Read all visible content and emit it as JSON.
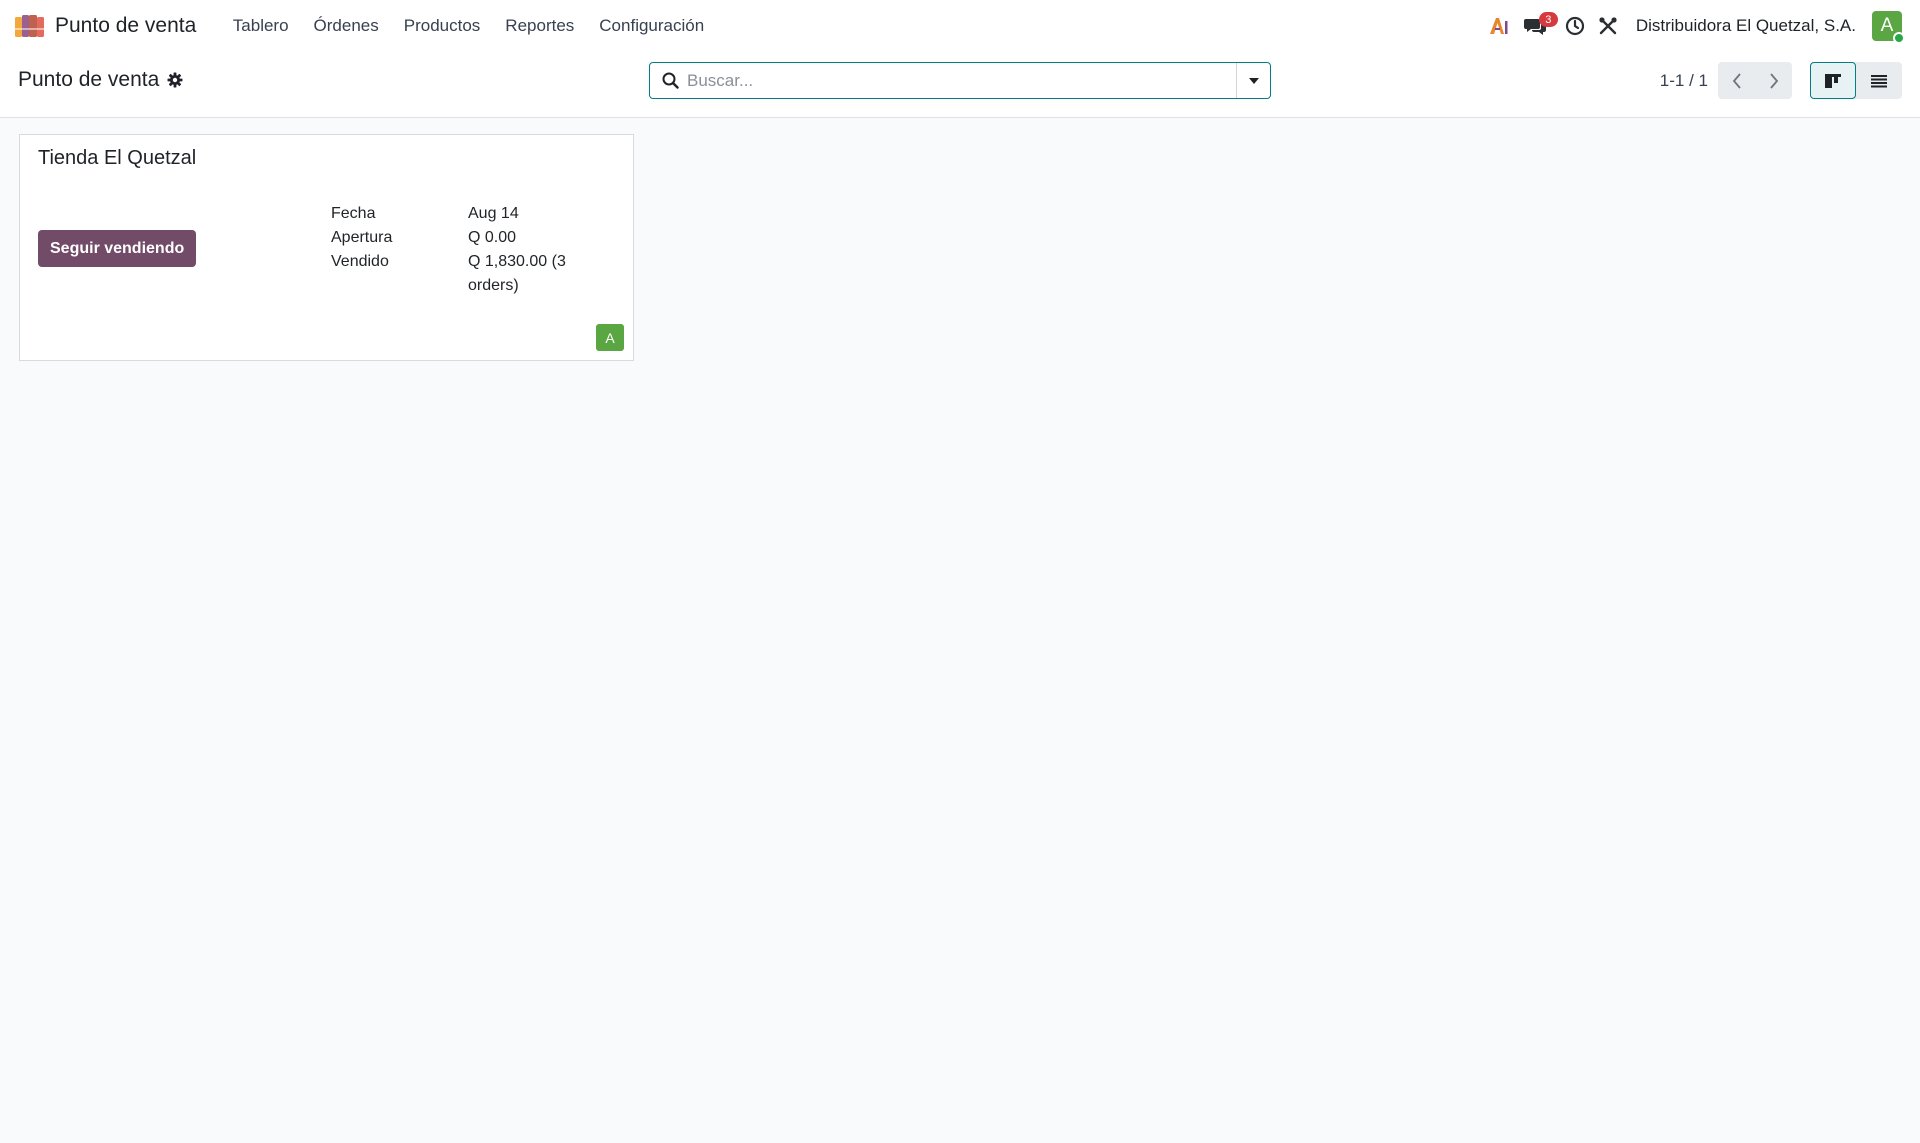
{
  "navbar": {
    "app_name": "Punto de venta",
    "menu": [
      {
        "label": "Tablero"
      },
      {
        "label": "Órdenes"
      },
      {
        "label": "Productos"
      },
      {
        "label": "Reportes"
      },
      {
        "label": "Configuración"
      }
    ],
    "systray": {
      "ai_icon": "ai-assistant-icon",
      "messages_icon": "chat-bubbles-icon",
      "messages_count": "3",
      "activity_icon": "clock-icon",
      "debug_icon": "tools-icon"
    },
    "company": "Distribuidora El Quetzal, S.A.",
    "avatar_initial": "A"
  },
  "control_panel": {
    "title": "Punto de venta",
    "search": {
      "placeholder": "Buscar...",
      "value": ""
    },
    "pager": "1-1 / 1",
    "views": [
      "kanban",
      "list"
    ],
    "active_view": "kanban"
  },
  "card": {
    "title": "Tienda El Quetzal",
    "button_label": "Seguir vendiendo",
    "fields": [
      {
        "label": "Fecha",
        "value": "Aug 14"
      },
      {
        "label": "Apertura",
        "value": "Q 0.00"
      },
      {
        "label": "Vendido",
        "value": "Q 1,830.00 (3 orders)"
      }
    ],
    "user_badge": "A"
  },
  "colors": {
    "brand": "#714b67",
    "accent": "#017e84",
    "avatar": "#5aa642",
    "badge": "#d63a3f"
  }
}
